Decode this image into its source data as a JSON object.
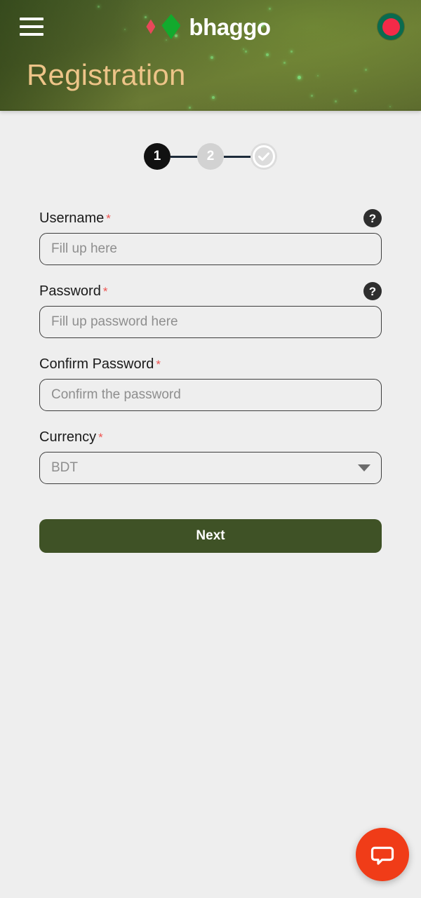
{
  "header": {
    "menu_icon": "hamburger-menu-icon",
    "brand_name": "bhaggo",
    "logo_icon": "bhaggo-diamond-logo",
    "flag_icon": "bangladesh-flag-icon",
    "page_title": "Registration",
    "bg_color": "#5d6c2e",
    "title_color": "#edc488"
  },
  "stepper": {
    "steps": [
      {
        "label": "1",
        "state": "active"
      },
      {
        "label": "2",
        "state": "idle"
      },
      {
        "label": "",
        "state": "check",
        "icon": "check-circle-icon"
      }
    ]
  },
  "form": {
    "fields": [
      {
        "label": "Username",
        "required": "*",
        "placeholder": "Fill up here",
        "value": "",
        "help_icon": "question-mark-icon",
        "help_label": "?"
      },
      {
        "label": "Password",
        "required": "*",
        "placeholder": "Fill up password here",
        "value": "",
        "help_icon": "question-mark-icon",
        "help_label": "?"
      },
      {
        "label": "Confirm Password",
        "required": "*",
        "placeholder": "Confirm the password",
        "value": ""
      },
      {
        "label": "Currency",
        "required": "*",
        "selected": "BDT",
        "caret_icon": "chevron-down-icon"
      }
    ],
    "submit_label": "Next",
    "submit_color": "#3f5226"
  },
  "chat": {
    "icon": "chat-bubble-icon",
    "color": "#f03c18"
  }
}
